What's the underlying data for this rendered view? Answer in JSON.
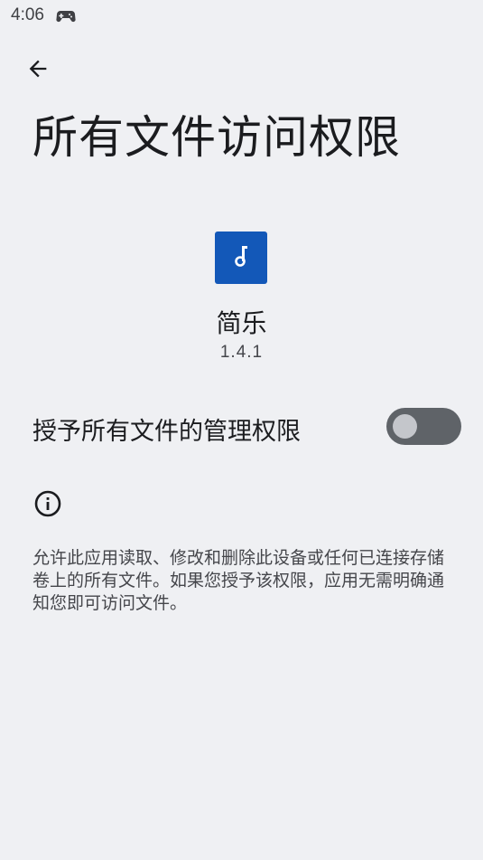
{
  "status_bar": {
    "time": "4:06",
    "game_icon": "gamepad-icon"
  },
  "header": {
    "back_icon": "arrow-back-icon",
    "title": "所有文件访问权限"
  },
  "app": {
    "icon": "music-note-icon",
    "icon_color": "#1358b8",
    "name": "简乐",
    "version": "1.4.1"
  },
  "permission": {
    "label": "授予所有文件的管理权限",
    "enabled": false
  },
  "info": {
    "icon": "info-icon",
    "description": "允许此应用读取、修改和删除此设备或任何已连接存储卷上的所有文件。如果您授予该权限，应用无需明确通知您即可访问文件。"
  }
}
